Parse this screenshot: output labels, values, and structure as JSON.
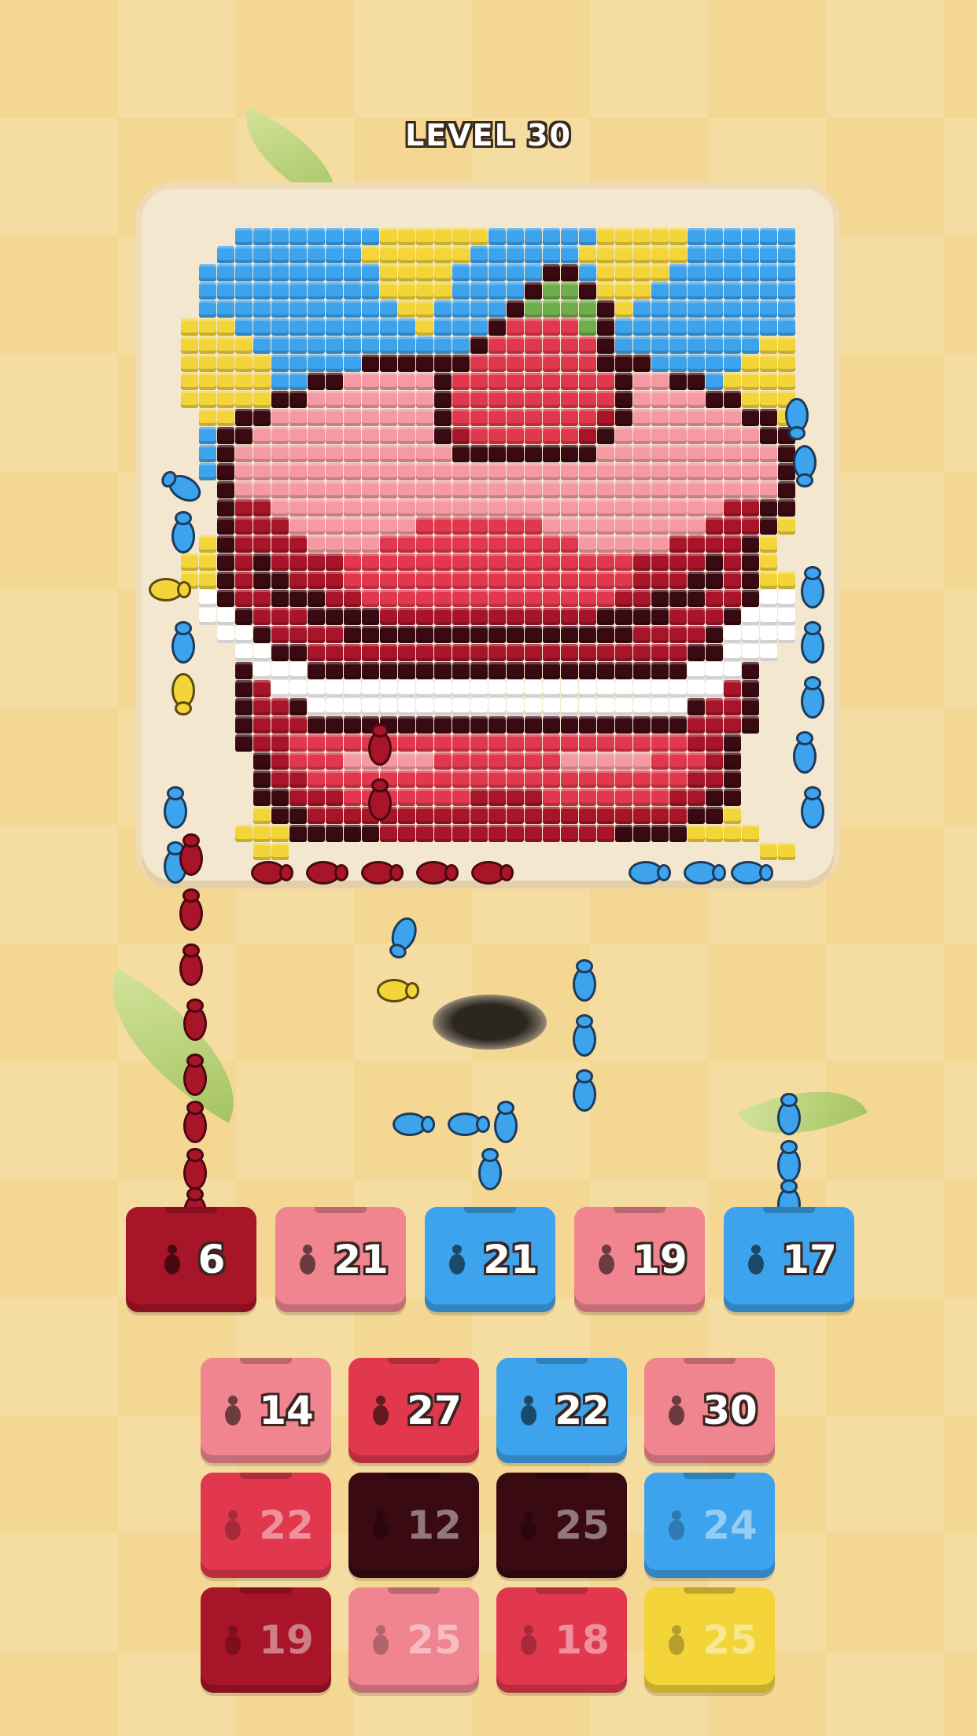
{
  "header": {
    "level_label": "LEVEL 30"
  },
  "colors": {
    "blue": "#3da3ec",
    "yellow": "#f3d53a",
    "green": "#6fae4a",
    "light_pink": "#f59aa3",
    "pink": "#f08590",
    "red": "#e2384e",
    "dark_red": "#a81428",
    "darkest": "#3a0a12",
    "white": "#ffffff",
    "board": "#f3e7d0",
    "background": "#f4d793"
  },
  "picture": {
    "palette": {
      ".": "none",
      "B": "#3da3ec",
      "Y": "#f3d53a",
      "G": "#6fae4a",
      "P": "#f59aa3",
      "R": "#e2384e",
      "D": "#a81428",
      "K": "#3a0a12",
      "W": "#ffffff"
    },
    "rows": [
      "...BBBBBBBBYYYYYYBBBBBBYYYYYBBBBBB",
      "..BBBBBBBBYYYYYYBBBBBBYYYYYYBBBBBB",
      ".BBBBBBBBBBYYYYBBBBBKKBYYYYBBBBBBB",
      ".BBBBBBBBBBYYYYBBBBKGGKYYYBBBBBBBB",
      ".BBBBBBBBBBBYYBBBBKGGGGKYBBBBBBBBB",
      "YYYBBBBBBBBBBYBBBKRRRRGKBBBBBBBBBB",
      "YYYYBBBBBBBBBBBBKRRRRRRKBBBBBBBBYY",
      "YYYYYBBBBBKKKKKKRRRRRRRKKKBBBBBYYY",
      "YYYYYBBKKPPPPPKRRRRRRRRRKPPKKBYYYY",
      "YYYYYKKPPPPPPPKRRRRRRRRRKPPPPKKYYY",
      ".YYKKPPPPPPPPPKRRRRRRRRDKPPPPPPKKY",
      ".BKKPPPPPPPPPPKDRRRRRRDKPPPPPPPPKK",
      ".BKPPPPPPPPPPPPKKKKKKKKPPPPPPPPPPK",
      ".BKPPPPPPPPPPPPPPPPPPPPPPPPPPPPPPK",
      "..KPPPPPPPPPPPPPPPPPPPPPPPPPPPPPPK",
      "..KDDPPPPPPPPPPPPPPPPPPPPPPPPPDDKK",
      "..KDDDPPPPPPPRRRRRRRPPPPPPPPPDDDKY",
      ".YKDDDDPPPPRRRRRRRRRRRPPPPPDDDDKY",
      "YYKDKDDDDRRRRRRRRRRRRRRRRDDDDKDKY",
      "YYKDKKDDDRRRRRRRRRRRRRRRRDDDKKDKYY",
      ".WKDDKKKDDRRRRRRRRRRRRRRDDKKKDDKWW",
      ".WWKDDDKKKKDDDDDDDDDDDDKKKKDDDKWWW",
      "..WWKDDDDKKKKKKKKKKKKKKKKDDDDKWWWW",
      "...WWKKDDDDDDDDDDDDDDDDDDDDDKKWWW.",
      "...KWWWKKKKKKKKKKKKKKKKKKKKKWWWK..",
      "...KDWWWWWWWWWWWWWWWWWWWWWWWWWDK..",
      "...KDDKWWWWWWWWWWWWWWWWWWWWWKDDK..",
      "...KDDDKKKKKKKKKKKKKKKKKKKKKDDDK..",
      "...KDDRRRRRRRRRRRRRRRRRRRRRRDDK...",
      "....KDRRRPPPPPRRRRRRRPPPPPRRRDK...",
      "....KDDRRRRRRRRRRRRRRRRRRRRRDDK...",
      "....KKDDDRRRRRRRDDDDRRRRRRRDDKK...",
      "....YKKDDDDDDDDDDDDDDDDDDDDDKKY...",
      "...YYYKKKKKDDDDDDDDDDDDDKKKKYYYY..",
      "....YY..........................YY"
    ]
  },
  "queue": [
    {
      "count": "6",
      "color": "#a81428"
    },
    {
      "count": "21",
      "color": "#f08590"
    },
    {
      "count": "21",
      "color": "#3da3ec"
    },
    {
      "count": "19",
      "color": "#f08590"
    },
    {
      "count": "17",
      "color": "#3da3ec"
    }
  ],
  "tray": [
    {
      "count": "14",
      "color": "#f08590",
      "state": "active"
    },
    {
      "count": "27",
      "color": "#e2384e",
      "state": "active"
    },
    {
      "count": "22",
      "color": "#3da3ec",
      "state": "active"
    },
    {
      "count": "30",
      "color": "#f08590",
      "state": "active"
    },
    {
      "count": "22",
      "color": "#e2384e",
      "state": "locked"
    },
    {
      "count": "12",
      "color": "#3a0a12",
      "state": "locked"
    },
    {
      "count": "25",
      "color": "#3a0a12",
      "state": "locked"
    },
    {
      "count": "24",
      "color": "#3da3ec",
      "state": "locked"
    },
    {
      "count": "19",
      "color": "#a81428",
      "state": "locked"
    },
    {
      "count": "25",
      "color": "#f08590",
      "state": "locked"
    },
    {
      "count": "18",
      "color": "#e2384e",
      "state": "locked"
    },
    {
      "count": "25",
      "color": "#f3d53a",
      "state": "locked"
    }
  ]
}
